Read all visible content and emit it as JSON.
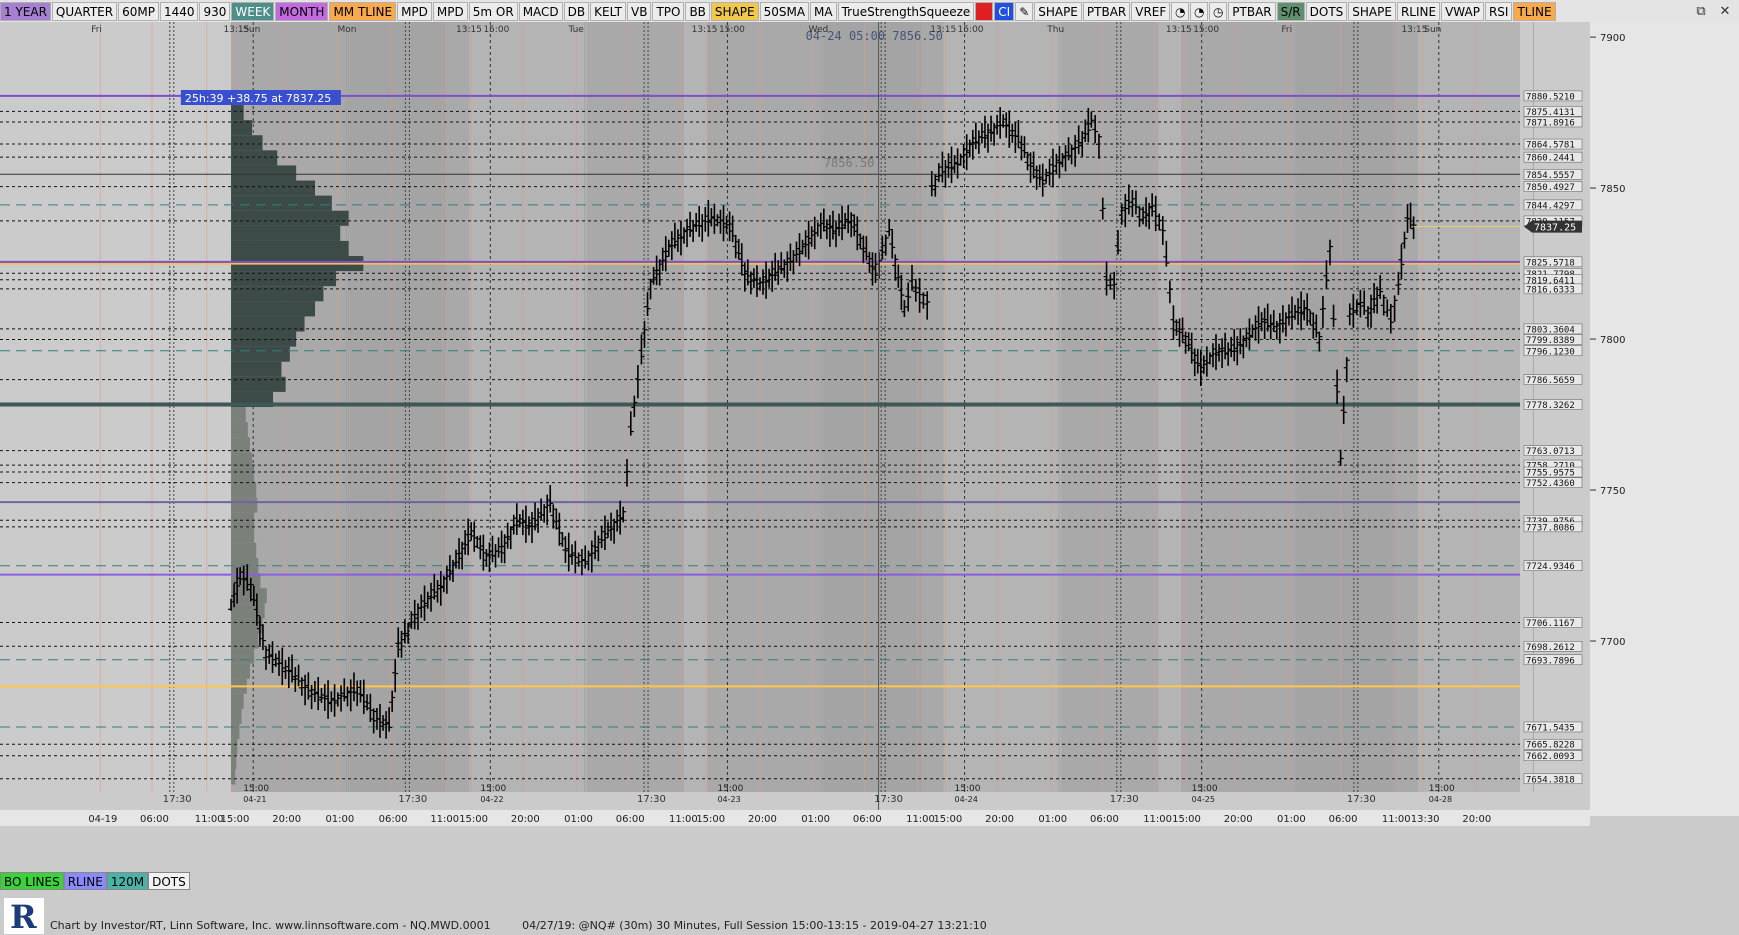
{
  "toolbar": {
    "buttons": [
      {
        "label": "1 YEAR",
        "bg": "#a77fd0"
      },
      {
        "label": "QUARTER",
        "bg": "#ececec"
      },
      {
        "label": "60MP",
        "bg": "#ececec"
      },
      {
        "label": "1440",
        "bg": "#ececec"
      },
      {
        "label": "930",
        "bg": "#ececec"
      },
      {
        "label": "WEEK",
        "bg": "#4f8f8a"
      },
      {
        "label": "MONTH",
        "bg": "#c46ae0"
      },
      {
        "label": "MM TLINE",
        "bg": "#f7a94c"
      },
      {
        "label": "MPD",
        "bg": "#ececec"
      },
      {
        "label": "MPD",
        "bg": "#ececec"
      },
      {
        "label": "5m OR",
        "bg": "#ececec"
      },
      {
        "label": "MACD",
        "bg": "#ececec"
      },
      {
        "label": "DB",
        "bg": "#ececec"
      },
      {
        "label": "KELT",
        "bg": "#ececec"
      },
      {
        "label": "VB",
        "bg": "#ececec"
      },
      {
        "label": "TPO",
        "bg": "#ececec"
      },
      {
        "label": "BB",
        "bg": "#ececec"
      },
      {
        "label": "SHAPE",
        "bg": "#f2c84b"
      },
      {
        "label": "50SMA",
        "bg": "#ececec"
      },
      {
        "label": "MA",
        "bg": "#ececec"
      },
      {
        "label": "TrueStrengthSqueeze",
        "bg": "#ececec"
      },
      {
        "label": "",
        "bg": "#e02020",
        "icon": "red-square-icon"
      },
      {
        "label": "CI",
        "bg": "#2050e0"
      },
      {
        "label": "✎",
        "bg": "#ececec",
        "icon": "pencil-icon"
      },
      {
        "label": "SHAPE",
        "bg": "#ececec"
      },
      {
        "label": "PTBAR",
        "bg": "#ececec"
      },
      {
        "label": "VREF",
        "bg": "#ececec"
      },
      {
        "label": "◔",
        "bg": "#ececec",
        "icon": "timer-icon"
      },
      {
        "label": "◔",
        "bg": "#ececec",
        "icon": "timer-icon"
      },
      {
        "label": "◷",
        "bg": "#ececec",
        "icon": "clock-icon"
      },
      {
        "label": "PTBAR",
        "bg": "#ececec"
      },
      {
        "label": "S/R",
        "bg": "#5f8f6f"
      },
      {
        "label": "DOTS",
        "bg": "#ececec"
      },
      {
        "label": "SHAPE",
        "bg": "#ececec"
      },
      {
        "label": "RLINE",
        "bg": "#ececec"
      },
      {
        "label": "VWAP",
        "bg": "#ececec"
      },
      {
        "label": "RSI",
        "bg": "#ececec"
      },
      {
        "label": "TLINE",
        "bg": "#f7a94c"
      }
    ],
    "window_controls": [
      "⧉",
      "✕"
    ]
  },
  "chart_data": {
    "type": "ohlc",
    "symbol": "@NQ#",
    "interval": "30 Minutes",
    "ylim": [
      7650,
      7905
    ],
    "y_ticks": [
      7900,
      7850,
      7800,
      7750,
      7700
    ],
    "current_price": "7837.25",
    "overlay_label": "04-24 05:00  7856.50",
    "ghost_label": "7856.50",
    "profile_label": "25h:39  +38.75 at 7837.25",
    "day_labels": [
      {
        "label": "Fri",
        "x": 0.06
      },
      {
        "label": "13:15",
        "x": 0.147
      },
      {
        "label": "Sun",
        "x": 0.16
      },
      {
        "label": "Mon",
        "x": 0.222
      },
      {
        "label": "13:15",
        "x": 0.3
      },
      {
        "label": "15:00",
        "x": 0.318
      },
      {
        "label": "Tue",
        "x": 0.374
      },
      {
        "label": "13:15",
        "x": 0.455
      },
      {
        "label": "15:00",
        "x": 0.473
      },
      {
        "label": "Wed",
        "x": 0.532
      },
      {
        "label": "13:15",
        "x": 0.612
      },
      {
        "label": "15:00",
        "x": 0.63
      },
      {
        "label": "Thu",
        "x": 0.689
      },
      {
        "label": "13:15",
        "x": 0.767
      },
      {
        "label": "15:00",
        "x": 0.785
      },
      {
        "label": "Fri",
        "x": 0.843
      },
      {
        "label": "13:15",
        "x": 0.922
      },
      {
        "label": "Sun",
        "x": 0.937
      }
    ],
    "time_ticks": [
      {
        "label": "04-19",
        "x": 0.066
      },
      {
        "label": "06:00",
        "x": 0.1
      },
      {
        "label": "11:00",
        "x": 0.136
      },
      {
        "label": "15:00",
        "x": 0.153
      },
      {
        "label": "20:00",
        "x": 0.187
      },
      {
        "label": "01:00",
        "x": 0.222
      },
      {
        "label": "06:00",
        "x": 0.257
      },
      {
        "label": "11:00",
        "x": 0.291
      },
      {
        "label": "15:00",
        "x": 0.31
      },
      {
        "label": "20:00",
        "x": 0.344
      },
      {
        "label": "01:00",
        "x": 0.379
      },
      {
        "label": "06:00",
        "x": 0.413
      },
      {
        "label": "11:00",
        "x": 0.448
      },
      {
        "label": "15:00",
        "x": 0.466
      },
      {
        "label": "20:00",
        "x": 0.5
      },
      {
        "label": "01:00",
        "x": 0.535
      },
      {
        "label": "06:00",
        "x": 0.569
      },
      {
        "label": "11:00",
        "x": 0.604
      },
      {
        "label": "15:00",
        "x": 0.622
      },
      {
        "label": "20:00",
        "x": 0.656
      },
      {
        "label": "01:00",
        "x": 0.691
      },
      {
        "label": "06:00",
        "x": 0.725
      },
      {
        "label": "11:00",
        "x": 0.76
      },
      {
        "label": "15:00",
        "x": 0.779
      },
      {
        "label": "20:00",
        "x": 0.813
      },
      {
        "label": "01:00",
        "x": 0.848
      },
      {
        "label": "06:00",
        "x": 0.882
      },
      {
        "label": "11:00",
        "x": 0.917
      },
      {
        "label": "13:30",
        "x": 0.936
      },
      {
        "label": "20:00",
        "x": 0.97
      }
    ],
    "session_labels": [
      {
        "label": "15:00",
        "sub": "04-21",
        "x": 0.16
      },
      {
        "label": "15:00",
        "sub": "04-22",
        "x": 0.316
      },
      {
        "label": "15:00",
        "sub": "04-23",
        "x": 0.472
      },
      {
        "label": "15:00",
        "sub": "04-24",
        "x": 0.628
      },
      {
        "label": "15:00",
        "sub": "04-25",
        "x": 0.784
      },
      {
        "label": "15:00",
        "sub": "04-28",
        "x": 0.94
      }
    ],
    "bottom_marks": [
      {
        "label": "17:30",
        "x": 0.115
      },
      {
        "label": "17:30",
        "x": 0.27
      },
      {
        "label": "17:30",
        "x": 0.427
      },
      {
        "label": "17:30",
        "x": 0.583
      },
      {
        "label": "17:30",
        "x": 0.738
      },
      {
        "label": "17:30",
        "x": 0.894
      }
    ],
    "levels": [
      {
        "label": "7880.5210",
        "v": 7880.52,
        "style": "purple"
      },
      {
        "label": "7875.4131",
        "v": 7875.41,
        "style": "dash"
      },
      {
        "label": "7871.8916",
        "v": 7871.89,
        "style": "dash"
      },
      {
        "label": "7864.5781",
        "v": 7864.58,
        "style": "dash"
      },
      {
        "label": "7860.2441",
        "v": 7860.24,
        "style": "dash"
      },
      {
        "label": "7854.5557",
        "v": 7854.56,
        "style": "solid"
      },
      {
        "label": "7850.4927",
        "v": 7850.49,
        "style": "dash"
      },
      {
        "label": "7844.4297",
        "v": 7844.43,
        "style": "teal"
      },
      {
        "label": "7839.1157",
        "v": 7839.12,
        "style": "dash"
      },
      {
        "label": "7825.5718",
        "v": 7825.57,
        "style": "purple"
      },
      {
        "label": "7821.7798",
        "v": 7821.78,
        "style": "dash"
      },
      {
        "label": "7819.6411",
        "v": 7819.64,
        "style": "dash"
      },
      {
        "label": "7816.6333",
        "v": 7816.63,
        "style": "dash"
      },
      {
        "label": "7803.3604",
        "v": 7803.36,
        "style": "dash"
      },
      {
        "label": "7799.8389",
        "v": 7799.84,
        "style": "dash"
      },
      {
        "label": "7796.1230",
        "v": 7796.12,
        "style": "teal"
      },
      {
        "label": "7786.5659",
        "v": 7786.57,
        "style": "dash"
      },
      {
        "label": "7778.3262",
        "v": 7778.33,
        "style": "thick"
      },
      {
        "label": "7763.0713",
        "v": 7763.07,
        "style": "dash"
      },
      {
        "label": "7758.2710",
        "v": 7758.27,
        "style": "dash"
      },
      {
        "label": "7755.9575",
        "v": 7755.96,
        "style": "dash"
      },
      {
        "label": "7752.4360",
        "v": 7752.44,
        "style": "dash"
      },
      {
        "label": "7739.9756",
        "v": 7739.98,
        "style": "dash"
      },
      {
        "label": "7737.8086",
        "v": 7737.81,
        "style": "dash"
      },
      {
        "label": "7724.9346",
        "v": 7724.93,
        "style": "teal"
      },
      {
        "label": "7706.1167",
        "v": 7706.12,
        "style": "dash"
      },
      {
        "label": "7698.2612",
        "v": 7698.26,
        "style": "dash"
      },
      {
        "label": "7693.7896",
        "v": 7693.79,
        "style": "teal"
      },
      {
        "label": "7671.5435",
        "v": 7671.54,
        "style": "teal"
      },
      {
        "label": "7665.8228",
        "v": 7665.82,
        "style": "dash"
      },
      {
        "label": "7662.0093",
        "v": 7662.01,
        "style": "dash"
      },
      {
        "label": "7654.3818",
        "v": 7654.38,
        "style": "dash"
      }
    ],
    "extra_lines": [
      {
        "v": 7825.0,
        "color": "#f3c14a"
      },
      {
        "v": 7746.0,
        "color": "#6f63a0"
      },
      {
        "v": 7722.0,
        "color": "#8a5ee0"
      },
      {
        "v": 7685.0,
        "color": "#ffc64a"
      }
    ],
    "price_path": [
      [
        0.152,
        7712
      ],
      [
        0.158,
        7722
      ],
      [
        0.165,
        7718
      ],
      [
        0.175,
        7696
      ],
      [
        0.19,
        7690
      ],
      [
        0.205,
        7683
      ],
      [
        0.218,
        7680
      ],
      [
        0.235,
        7684
      ],
      [
        0.248,
        7674
      ],
      [
        0.256,
        7672
      ],
      [
        0.262,
        7698
      ],
      [
        0.275,
        7710
      ],
      [
        0.29,
        7718
      ],
      [
        0.3,
        7726
      ],
      [
        0.31,
        7736
      ],
      [
        0.32,
        7728
      ],
      [
        0.33,
        7730
      ],
      [
        0.34,
        7740
      ],
      [
        0.35,
        7738
      ],
      [
        0.362,
        7746
      ],
      [
        0.372,
        7730
      ],
      [
        0.385,
        7726
      ],
      [
        0.398,
        7735
      ],
      [
        0.41,
        7742
      ],
      [
        0.415,
        7770
      ],
      [
        0.422,
        7795
      ],
      [
        0.428,
        7818
      ],
      [
        0.44,
        7830
      ],
      [
        0.452,
        7836
      ],
      [
        0.468,
        7840
      ],
      [
        0.48,
        7838
      ],
      [
        0.49,
        7822
      ],
      [
        0.5,
        7818
      ],
      [
        0.51,
        7822
      ],
      [
        0.52,
        7826
      ],
      [
        0.528,
        7830
      ],
      [
        0.54,
        7838
      ],
      [
        0.55,
        7836
      ],
      [
        0.56,
        7840
      ],
      [
        0.568,
        7830
      ],
      [
        0.576,
        7822
      ],
      [
        0.585,
        7836
      ],
      [
        0.595,
        7810
      ],
      [
        0.6,
        7818
      ],
      [
        0.605,
        7815
      ],
      [
        0.61,
        7812
      ],
      [
        0.613,
        7850
      ],
      [
        0.62,
        7856
      ],
      [
        0.63,
        7858
      ],
      [
        0.64,
        7865
      ],
      [
        0.65,
        7868
      ],
      [
        0.66,
        7872
      ],
      [
        0.67,
        7866
      ],
      [
        0.678,
        7858
      ],
      [
        0.686,
        7852
      ],
      [
        0.695,
        7858
      ],
      [
        0.705,
        7862
      ],
      [
        0.712,
        7866
      ],
      [
        0.718,
        7872
      ],
      [
        0.723,
        7866
      ],
      [
        0.728,
        7820
      ],
      [
        0.733,
        7818
      ],
      [
        0.738,
        7842
      ],
      [
        0.745,
        7846
      ],
      [
        0.752,
        7840
      ],
      [
        0.758,
        7844
      ],
      [
        0.765,
        7836
      ],
      [
        0.772,
        7806
      ],
      [
        0.78,
        7800
      ],
      [
        0.79,
        7790
      ],
      [
        0.8,
        7796
      ],
      [
        0.81,
        7796
      ],
      [
        0.82,
        7800
      ],
      [
        0.83,
        7806
      ],
      [
        0.84,
        7804
      ],
      [
        0.85,
        7808
      ],
      [
        0.86,
        7810
      ],
      [
        0.868,
        7800
      ],
      [
        0.875,
        7830
      ],
      [
        0.882,
        7760
      ],
      [
        0.888,
        7808
      ],
      [
        0.895,
        7812
      ],
      [
        0.9,
        7808
      ],
      [
        0.908,
        7816
      ],
      [
        0.915,
        7806
      ],
      [
        0.92,
        7818
      ],
      [
        0.926,
        7840
      ],
      [
        0.93,
        7837.25
      ]
    ],
    "volume_profile": [
      [
        7655,
        4
      ],
      [
        7660,
        5
      ],
      [
        7665,
        6
      ],
      [
        7670,
        8
      ],
      [
        7675,
        10
      ],
      [
        7680,
        12
      ],
      [
        7685,
        15
      ],
      [
        7690,
        18
      ],
      [
        7695,
        22
      ],
      [
        7700,
        26
      ],
      [
        7705,
        30
      ],
      [
        7710,
        32
      ],
      [
        7715,
        34
      ],
      [
        7720,
        28
      ],
      [
        7725,
        26
      ],
      [
        7730,
        24
      ],
      [
        7735,
        22
      ],
      [
        7740,
        22
      ],
      [
        7745,
        25
      ],
      [
        7750,
        24
      ],
      [
        7755,
        22
      ],
      [
        7760,
        20
      ],
      [
        7765,
        18
      ],
      [
        7770,
        16
      ],
      [
        7775,
        14
      ],
      [
        7780,
        40
      ],
      [
        7785,
        52
      ],
      [
        7790,
        48
      ],
      [
        7795,
        56
      ],
      [
        7800,
        62
      ],
      [
        7805,
        70
      ],
      [
        7810,
        80
      ],
      [
        7815,
        88
      ],
      [
        7820,
        100
      ],
      [
        7825,
        126
      ],
      [
        7830,
        112
      ],
      [
        7835,
        104
      ],
      [
        7840,
        112
      ],
      [
        7845,
        96
      ],
      [
        7850,
        80
      ],
      [
        7855,
        62
      ],
      [
        7860,
        44
      ],
      [
        7865,
        30
      ],
      [
        7870,
        20
      ],
      [
        7875,
        12
      ],
      [
        7880,
        6
      ]
    ]
  },
  "bottom_buttons": [
    {
      "label": "BO LINES",
      "bg": "#39d239"
    },
    {
      "label": "RLINE",
      "bg": "#8a8aff"
    },
    {
      "label": "120M",
      "bg": "#4ab3a8"
    },
    {
      "label": "DOTS",
      "bg": "#f2f2f2"
    }
  ],
  "footer": {
    "left": "Chart by Investor/RT, Linn Software, Inc. www.linnsoftware.com - NQ.MWD.0001",
    "right": "04/27/19: @NQ# (30m) 30 Minutes, Full Session 15:00-13:15 - 2019-04-27 13:21:10"
  }
}
